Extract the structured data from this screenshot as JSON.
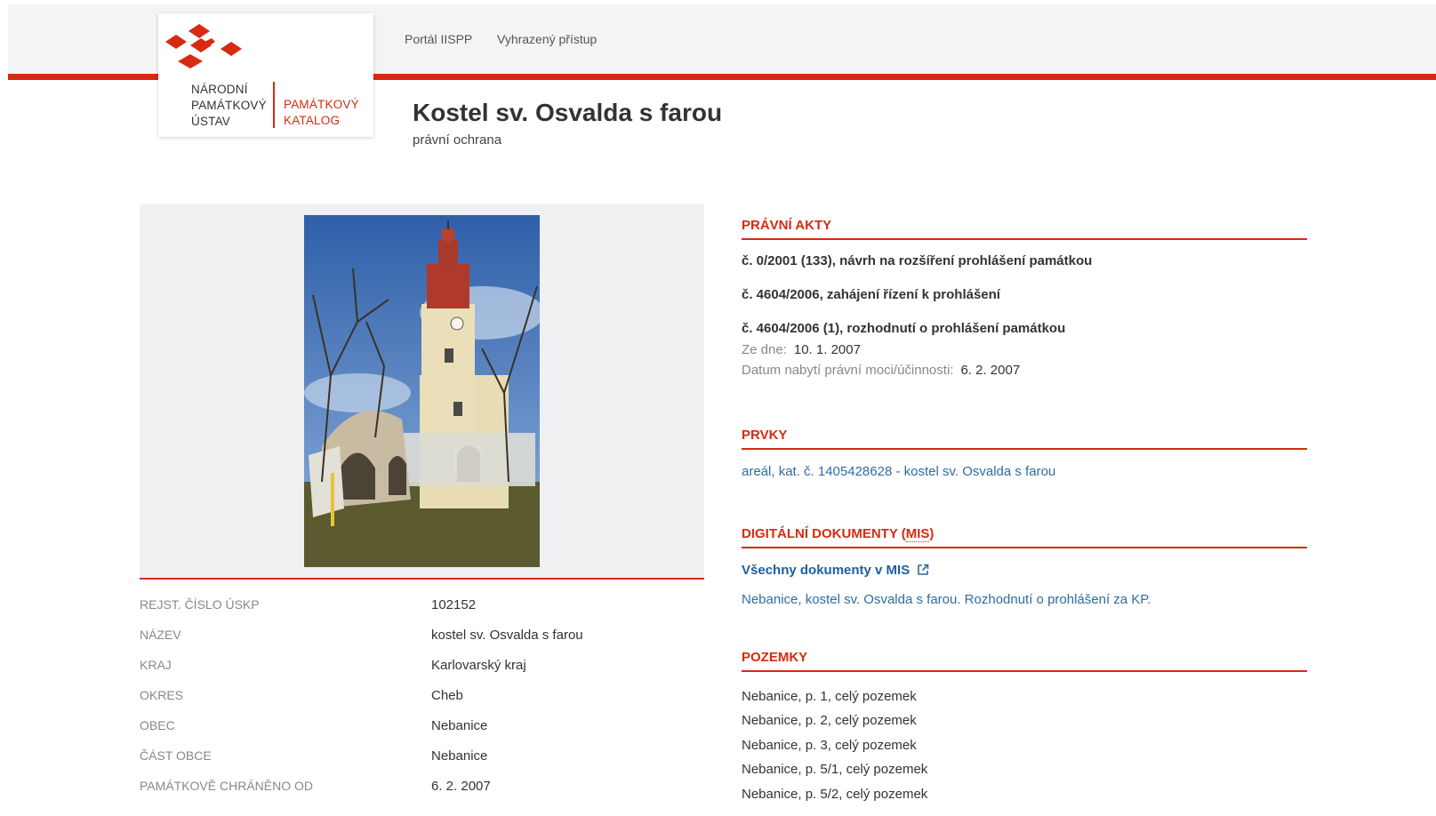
{
  "header": {
    "logo_left_lines": [
      "NÁRODNÍ",
      "PAMÁTKOVÝ",
      "ÚSTAV"
    ],
    "logo_right_lines": [
      "PAMÁTKOVÝ",
      "KATALOG"
    ],
    "nav": [
      {
        "label": "Portál IISPP"
      },
      {
        "label": "Vyhrazený přístup"
      }
    ]
  },
  "page": {
    "title": "Kostel sv. Osvalda s farou",
    "subtitle": "právní ochrana"
  },
  "info": [
    {
      "label": "Rejst. číslo ÚSKP",
      "value": "102152"
    },
    {
      "label": "Název",
      "value": "kostel sv. Osvalda s farou"
    },
    {
      "label": "Kraj",
      "value": "Karlovarský kraj"
    },
    {
      "label": "Okres",
      "value": "Cheb"
    },
    {
      "label": "Obec",
      "value": "Nebanice"
    },
    {
      "label": "Část obce",
      "value": "Nebanice"
    },
    {
      "label": "Památkově chráněno od",
      "value": "6. 2. 2007"
    }
  ],
  "legal_acts": {
    "heading": "Právní akty",
    "items": [
      {
        "title": "č. 0/2001 (133), návrh na rozšíření prohlášení památkou"
      },
      {
        "title": "č. 4604/2006, zahájení řízení k prohlášení"
      },
      {
        "title": "č. 4604/2006 (1), rozhodnutí o prohlášení památkou",
        "date_label": "Ze dne:",
        "date_value": "10. 1. 2007",
        "effective_label": "Datum nabytí právní moci/účinnosti:",
        "effective_value": "6. 2. 2007"
      }
    ]
  },
  "elements": {
    "heading": "Prvky",
    "items": [
      {
        "label": "areál, kat. č. 1405428628 - kostel sv. Osvalda s farou"
      }
    ]
  },
  "digital_docs": {
    "heading_prefix": "Digitální dokumenty (",
    "heading_abbr": "MIS",
    "heading_suffix": ")",
    "all_docs_label": "Všechny dokumenty v MIS",
    "items": [
      {
        "label": "Nebanice, kostel sv. Osvalda s farou. Rozhodnutí o prohlášení za KP."
      }
    ]
  },
  "plots": {
    "heading": "Pozemky",
    "items": [
      {
        "label": "Nebanice, p. 1, celý pozemek"
      },
      {
        "label": "Nebanice, p. 2, celý pozemek"
      },
      {
        "label": "Nebanice, p. 3, celý pozemek"
      },
      {
        "label": "Nebanice, p. 5/1, celý pozemek"
      },
      {
        "label": "Nebanice, p. 5/2, celý pozemek"
      }
    ]
  },
  "colors": {
    "accent": "#d62b10",
    "link": "#2e6da4",
    "header_bg": "#f3f4f5",
    "panel_bg": "#eef0f1"
  },
  "icons": {
    "logo": "npu-logo-icon",
    "external_link": "external-link-icon"
  }
}
